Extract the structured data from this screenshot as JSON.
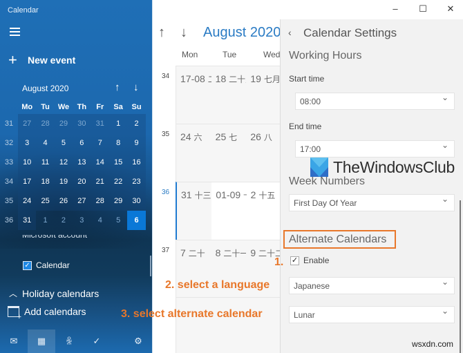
{
  "app": {
    "title": "Calendar"
  },
  "sidebar": {
    "new_event_label": "New event",
    "mini_calendar": {
      "month_label": "August 2020",
      "day_headers": [
        "Mo",
        "Tu",
        "We",
        "Th",
        "Fr",
        "Sa",
        "Su"
      ],
      "weeks": [
        {
          "num": "31",
          "days": [
            {
              "d": "27",
              "type": "dim"
            },
            {
              "d": "28",
              "type": "dim"
            },
            {
              "d": "29",
              "type": "dim"
            },
            {
              "d": "30",
              "type": "dim"
            },
            {
              "d": "31",
              "type": "dim"
            },
            {
              "d": "1",
              "type": "in"
            },
            {
              "d": "2",
              "type": "in"
            }
          ]
        },
        {
          "num": "32",
          "days": [
            {
              "d": "3",
              "type": "in"
            },
            {
              "d": "4",
              "type": "in"
            },
            {
              "d": "5",
              "type": "in"
            },
            {
              "d": "6",
              "type": "in"
            },
            {
              "d": "7",
              "type": "in"
            },
            {
              "d": "8",
              "type": "in"
            },
            {
              "d": "9",
              "type": "in"
            }
          ]
        },
        {
          "num": "33",
          "days": [
            {
              "d": "10",
              "type": "in"
            },
            {
              "d": "11",
              "type": "in"
            },
            {
              "d": "12",
              "type": "in"
            },
            {
              "d": "13",
              "type": "in"
            },
            {
              "d": "14",
              "type": "in"
            },
            {
              "d": "15",
              "type": "in"
            },
            {
              "d": "16",
              "type": "in"
            }
          ]
        },
        {
          "num": "34",
          "days": [
            {
              "d": "17",
              "type": "in"
            },
            {
              "d": "18",
              "type": "in"
            },
            {
              "d": "19",
              "type": "in"
            },
            {
              "d": "20",
              "type": "in"
            },
            {
              "d": "21",
              "type": "in"
            },
            {
              "d": "22",
              "type": "in"
            },
            {
              "d": "23",
              "type": "in"
            }
          ]
        },
        {
          "num": "35",
          "days": [
            {
              "d": "24",
              "type": "in"
            },
            {
              "d": "25",
              "type": "in"
            },
            {
              "d": "26",
              "type": "in"
            },
            {
              "d": "27",
              "type": "in"
            },
            {
              "d": "28",
              "type": "in"
            },
            {
              "d": "29",
              "type": "in"
            },
            {
              "d": "30",
              "type": "in"
            }
          ]
        },
        {
          "num": "36",
          "days": [
            {
              "d": "31",
              "type": "in"
            },
            {
              "d": "1",
              "type": "dim-out"
            },
            {
              "d": "2",
              "type": "dim-out"
            },
            {
              "d": "3",
              "type": "dim-out"
            },
            {
              "d": "4",
              "type": "dim-out"
            },
            {
              "d": "5",
              "type": "dim-out"
            },
            {
              "d": "6",
              "type": "today"
            }
          ]
        }
      ]
    },
    "account_label": "Microsoft account",
    "calendar_item_label": "Calendar",
    "calendar_item_checked": true,
    "holiday_label": "Holiday calendars",
    "add_calendars_label": "Add calendars",
    "bottom_nav": [
      {
        "name": "mail",
        "icon": "✉",
        "active": false
      },
      {
        "name": "calendar",
        "icon": "▦",
        "active": true
      },
      {
        "name": "people",
        "icon": "ꆜ",
        "active": false
      },
      {
        "name": "todo",
        "icon": "✓",
        "active": false
      },
      {
        "name": "settings",
        "icon": "⚙",
        "active": false
      }
    ]
  },
  "main": {
    "month_title": "August 2020",
    "day_headers": [
      "Mon",
      "Tue",
      "Wed"
    ],
    "weeks": [
      {
        "num": "34",
        "current": false,
        "days": [
          {
            "date": "17-08",
            "lunar": "二十八"
          },
          {
            "date": "18",
            "lunar": "二十九"
          },
          {
            "date": "19",
            "lunar": "七月"
          }
        ]
      },
      {
        "num": "35",
        "current": false,
        "days": [
          {
            "date": "24",
            "lunar": "六"
          },
          {
            "date": "25",
            "lunar": "七"
          },
          {
            "date": "26",
            "lunar": "八"
          }
        ]
      },
      {
        "num": "36",
        "current": true,
        "days": [
          {
            "date": "31",
            "lunar": "十三"
          },
          {
            "date": "01-09",
            "lunar": "十四"
          },
          {
            "date": "2",
            "lunar": "十五"
          }
        ]
      },
      {
        "num": "37",
        "current": false,
        "days": [
          {
            "date": "7",
            "lunar": "二十"
          },
          {
            "date": "8",
            "lunar": "二十一"
          },
          {
            "date": "9",
            "lunar": "二十二"
          }
        ]
      }
    ]
  },
  "window": {
    "minimize": "–",
    "maximize": "☐",
    "close": "✕"
  },
  "settings": {
    "back_icon": "‹",
    "title": "Calendar Settings",
    "working_hours": {
      "heading": "Working Hours",
      "start_label": "Start time",
      "start_value": "08:00",
      "end_label": "End time",
      "end_value": "17:00"
    },
    "week_numbers": {
      "heading": "Week Numbers",
      "value": "First Day Of Year"
    },
    "alternate_calendars": {
      "heading": "Alternate Calendars",
      "enable_label": "Enable",
      "enabled": true,
      "language_value": "Japanese",
      "calendar_value": "Lunar"
    }
  },
  "annotations": {
    "step1": "1.",
    "step2": "2. select a language",
    "step3": "3. select alternate calendar",
    "accent_color": "#e8772a"
  },
  "watermarks": {
    "brand": "TheWindowsClub",
    "site": "wsxdn.com"
  }
}
